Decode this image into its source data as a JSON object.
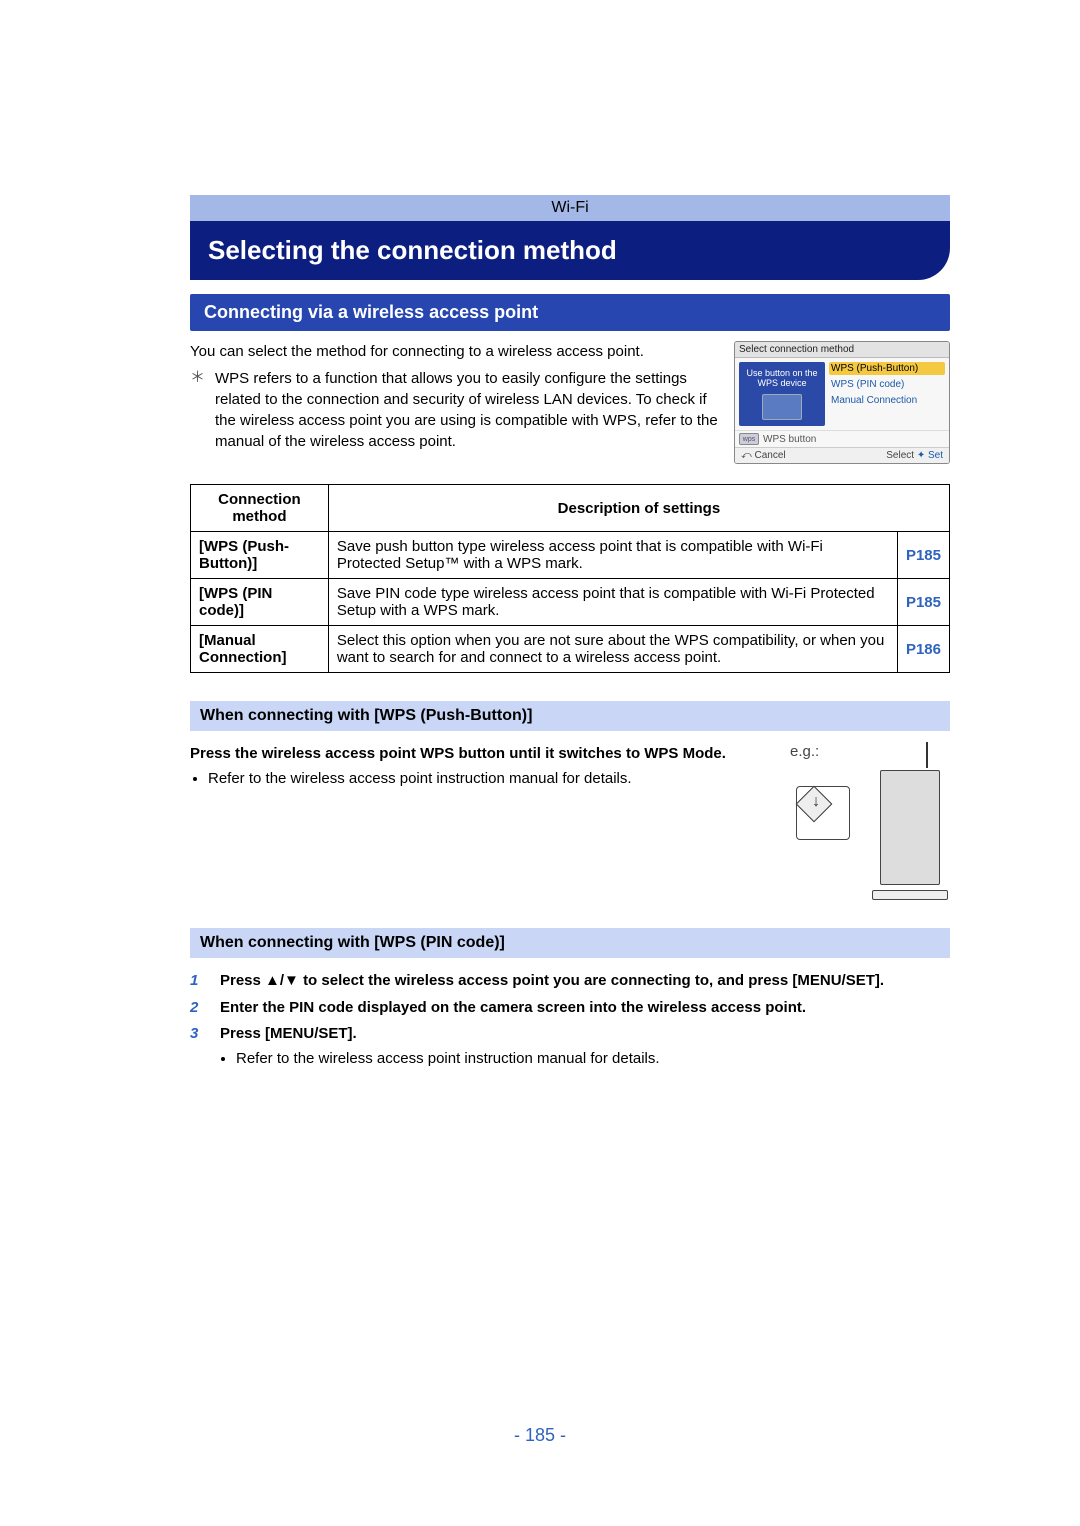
{
  "header": {
    "category": "Wi-Fi",
    "title": "Selecting the connection method",
    "subtitle": "Connecting via a wireless access point"
  },
  "intro": {
    "line": "You can select the method for connecting to a wireless access point.",
    "note_marker": "＊",
    "note": "WPS refers to a function that allows you to easily configure the settings related to the connection and security of wireless LAN devices. To check if the wireless access point you are using is compatible with WPS, refer to the manual of the wireless access point."
  },
  "side_panel": {
    "title": "Select connection method",
    "left_text": "Use button on the WPS device",
    "options": [
      "WPS (Push-Button)",
      "WPS (PIN code)",
      "Manual Connection"
    ],
    "wps_btn": "WPS button",
    "cancel": "⤺ Cancel",
    "select": "Select",
    "set": "Set"
  },
  "table": {
    "headers": [
      "Connection method",
      "Description of settings"
    ],
    "rows": [
      {
        "method": "[WPS (Push-Button)]",
        "desc": "Save push button type wireless access point that is compatible with Wi-Fi Protected Setup™ with a WPS mark.",
        "page": "P185"
      },
      {
        "method": "[WPS (PIN code)]",
        "desc": "Save PIN code type wireless access point that is compatible with Wi-Fi Protected Setup with a WPS mark.",
        "page": "P185"
      },
      {
        "method": "[Manual Connection]",
        "desc": "Select this option when you are not sure about the WPS compatibility, or when you want to search for and connect to a wireless access point.",
        "page": "P186"
      }
    ]
  },
  "sections": [
    {
      "bar": "When connecting with [WPS (Push-Button)]",
      "lead": "Press the wireless access point WPS button until it switches to WPS Mode.",
      "eg": "e.g.:",
      "bullet": "Refer to the wireless access point instruction manual for details."
    },
    {
      "bar": "When connecting with [WPS (PIN code)]",
      "steps": [
        {
          "num": "1",
          "text": "Press ▲/▼ to select the wireless access point you are connecting to, and press [MENU/SET]."
        },
        {
          "num": "2",
          "text": "Enter the PIN code displayed on the camera screen into the wireless access point."
        },
        {
          "num": "3",
          "text": "Press [MENU/SET].",
          "sub": "Refer to the wireless access point instruction manual for details."
        }
      ]
    }
  ],
  "page_number": "- 185 -"
}
